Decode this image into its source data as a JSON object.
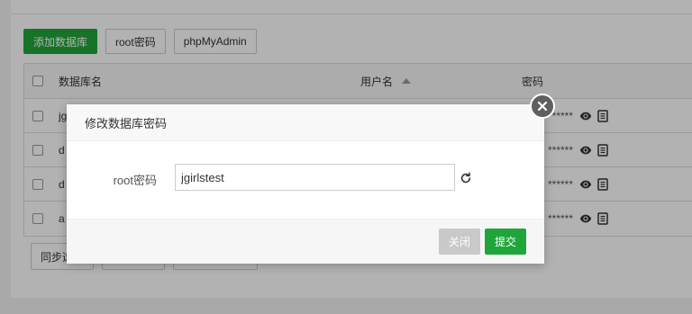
{
  "toolbar": {
    "add_db": "添加数据库",
    "root_pwd": "root密码",
    "phpmyadmin": "phpMyAdmin"
  },
  "table": {
    "headers": {
      "name": "数据库名",
      "user": "用户名",
      "password": "密码"
    },
    "rows": [
      {
        "name_partial": "jg",
        "password_mask": "******"
      },
      {
        "name_partial": "d",
        "password_mask": "******"
      },
      {
        "name_partial": "d",
        "password_mask": "******"
      },
      {
        "name_partial": "a",
        "password_mask": "******"
      }
    ]
  },
  "bottom": {
    "sync_partial": "同步选"
  },
  "modal": {
    "title": "修改数据库密码",
    "field_label": "root密码",
    "field_value": "jgirlstest",
    "close_button": "关闭",
    "submit_button": "提交"
  },
  "colors": {
    "accent": "#20a53a",
    "overlay": "rgba(0,0,0,0.30)"
  },
  "icons": [
    "eye-icon",
    "copy-icon",
    "refresh-icon",
    "close-icon",
    "sort-asc-icon"
  ]
}
